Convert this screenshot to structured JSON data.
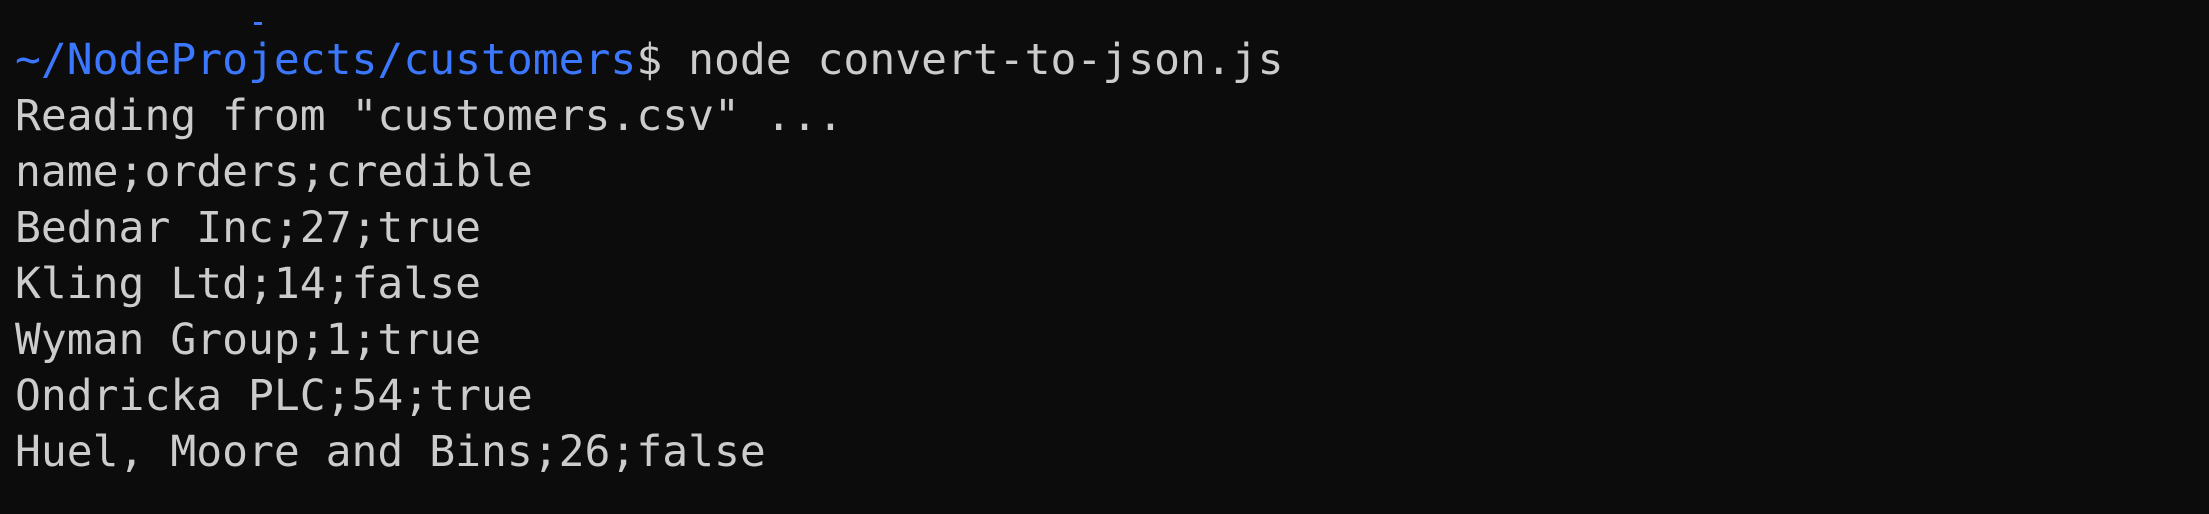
{
  "theme": {
    "background": "#0c0c0c",
    "foreground": "#cccccc",
    "prompt_path_color": "#3b78ff"
  },
  "prompt": {
    "path": "~/NodeProjects/customers",
    "symbol": "$",
    "command": " node convert-to-json.js"
  },
  "output": [
    "Reading from \"customers.csv\" ...",
    "name;orders;credible",
    "Bednar Inc;27;true",
    "Kling Ltd;14;false",
    "Wyman Group;1;true",
    "Ondricka PLC;54;true",
    "Huel, Moore and Bins;26;false"
  ]
}
